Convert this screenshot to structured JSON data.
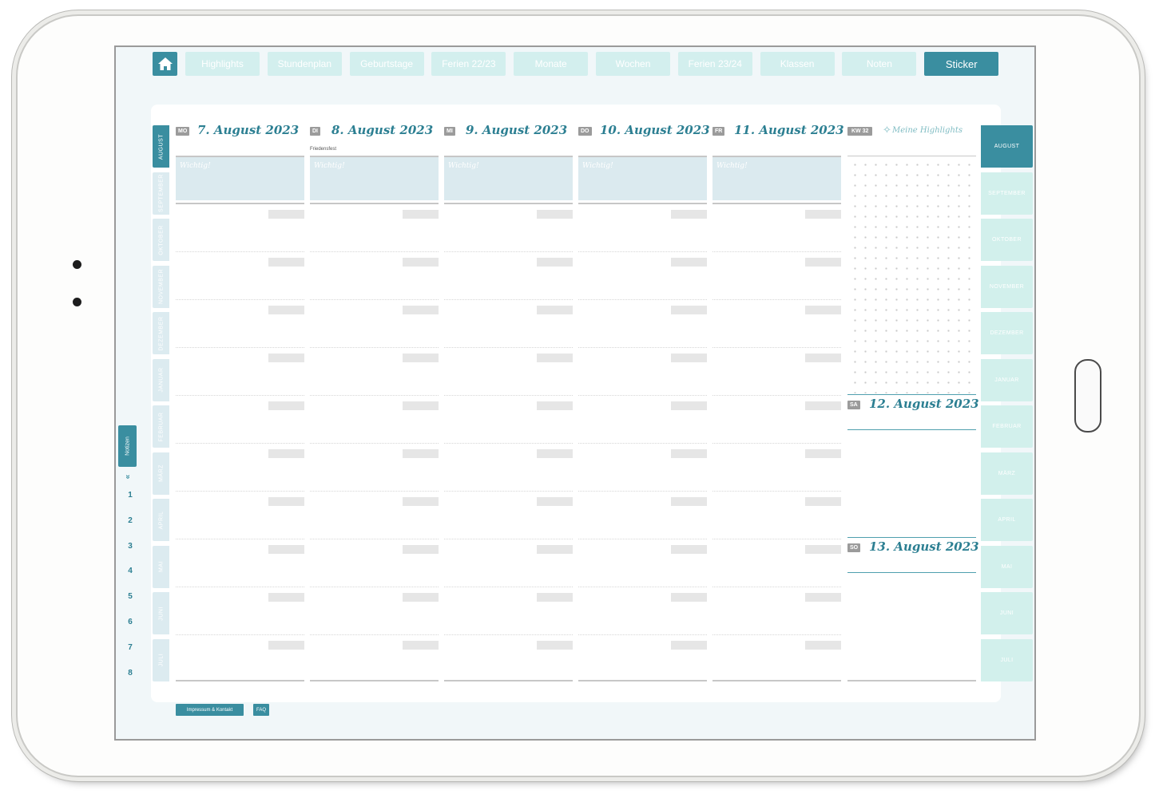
{
  "nav": {
    "home_icon": "home-icon",
    "tabs": [
      {
        "label": "Highlights"
      },
      {
        "label": "Stundenplan"
      },
      {
        "label": "Geburtstage"
      },
      {
        "label": "Ferien 22/23"
      },
      {
        "label": "Monate"
      },
      {
        "label": "Wochen"
      },
      {
        "label": "Ferien 23/24"
      },
      {
        "label": "Klassen"
      },
      {
        "label": "Noten"
      },
      {
        "label": "Sticker"
      }
    ],
    "active": "Sticker"
  },
  "months_left": [
    "AUGUST",
    "SEPTEMBER",
    "OKTOBER",
    "NOVEMBER",
    "DEZEMBER",
    "JANUAR",
    "FEBRUAR",
    "MÄRZ",
    "APRIL",
    "MAI",
    "JUNI",
    "JULI"
  ],
  "months_right": [
    "AUGUST",
    "SEPTEMBER",
    "OKTOBER",
    "NOVEMBER",
    "DEZEMBER",
    "JANUAR",
    "FEBRUAR",
    "MÄRZ",
    "APRIL",
    "MAI",
    "JUNI",
    "JULI"
  ],
  "active_month": "AUGUST",
  "notes": {
    "label": "Notizen",
    "chevron": "»",
    "pages": [
      "1",
      "2",
      "3",
      "4",
      "5",
      "6",
      "7",
      "8"
    ]
  },
  "days": [
    {
      "abbr": "MO",
      "title": "7. August 2023",
      "holiday": "",
      "important": "Wichtig!"
    },
    {
      "abbr": "DI",
      "title": "8. August 2023",
      "holiday": "Friedensfest",
      "important": "Wichtig!"
    },
    {
      "abbr": "MI",
      "title": "9. August 2023",
      "holiday": "",
      "important": "Wichtig!"
    },
    {
      "abbr": "DO",
      "title": "10. August 2023",
      "holiday": "",
      "important": "Wichtig!"
    },
    {
      "abbr": "FR",
      "title": "11. August 2023",
      "holiday": "",
      "important": "Wichtig!"
    }
  ],
  "week": {
    "label": "KW 32",
    "highlights_title": "Meine Highlights",
    "highlights_icon": "sparkle-icon"
  },
  "weekend": [
    {
      "abbr": "SA",
      "title": "12. August 2023"
    },
    {
      "abbr": "SO",
      "title": "13. August 2023"
    }
  ],
  "footer": {
    "impressum": "Impressum & Kontakt",
    "faq": "FAQ"
  },
  "colors": {
    "accent": "#3a8ea0",
    "tab_inactive": "#d3efee",
    "important_bg": "#dbeaef",
    "title": "#2c7f92"
  }
}
